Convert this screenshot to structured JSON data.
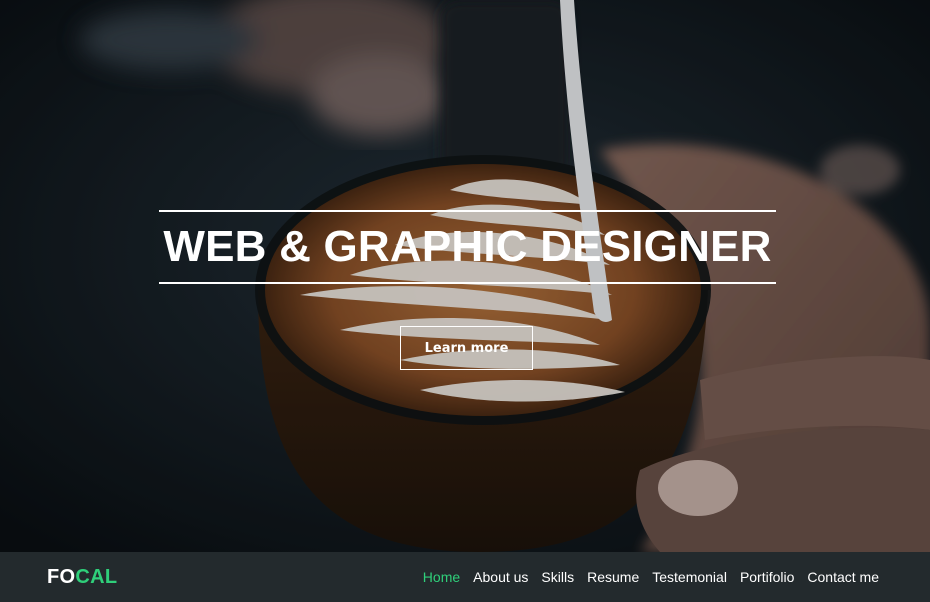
{
  "hero": {
    "headline": "WEB & GRAPHIC DESIGNER",
    "cta_label": "Learn more"
  },
  "navbar": {
    "brand_part1": "FO",
    "brand_part2": "CAL",
    "accent_color": "#2fcf7a",
    "items": [
      {
        "label": "Home",
        "active": true
      },
      {
        "label": "About us",
        "active": false
      },
      {
        "label": "Skills",
        "active": false
      },
      {
        "label": "Resume",
        "active": false
      },
      {
        "label": "Testemonial",
        "active": false
      },
      {
        "label": "Portifolio",
        "active": false
      },
      {
        "label": "Contact me",
        "active": false
      }
    ]
  }
}
